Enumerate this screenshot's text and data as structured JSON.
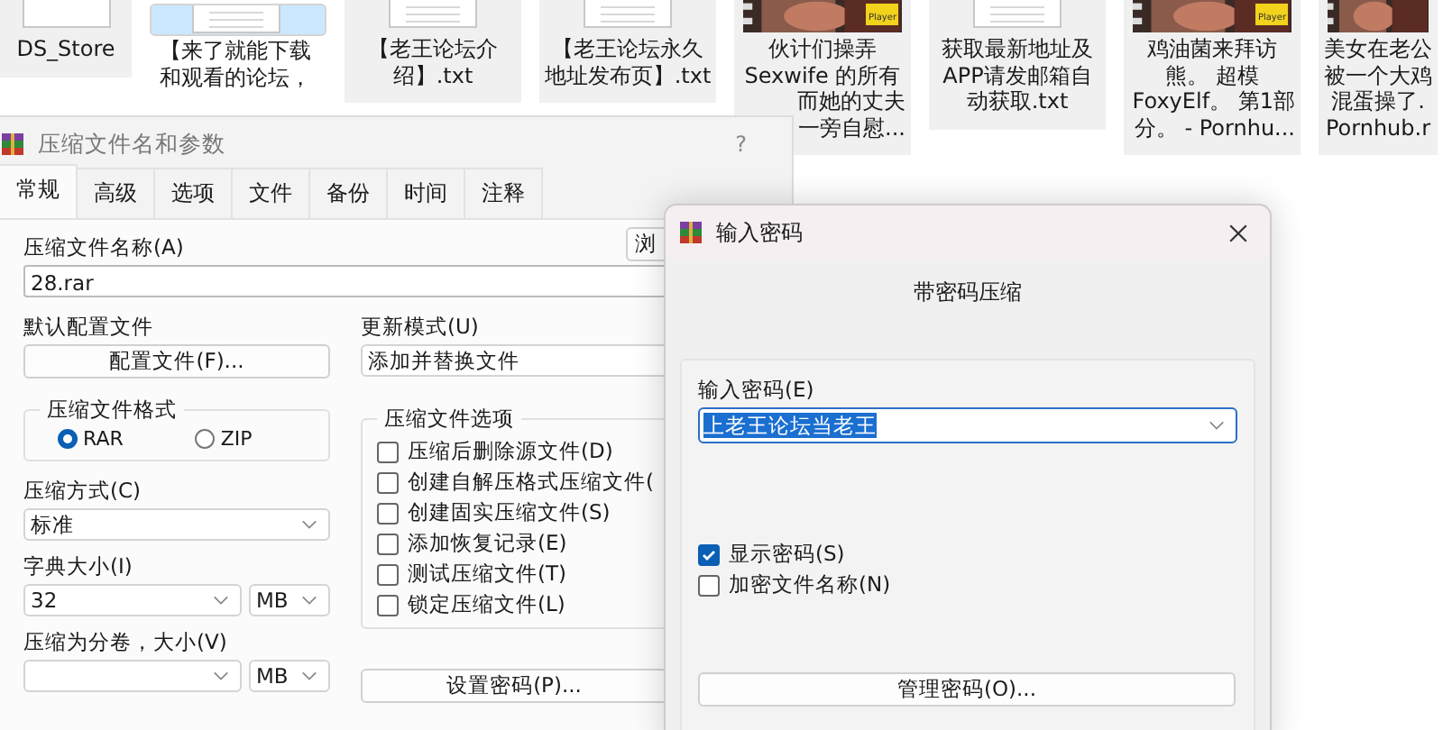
{
  "explorer": {
    "files": [
      {
        "kind": "file",
        "selected": false,
        "lines": [
          "DS_Store"
        ]
      },
      {
        "kind": "document",
        "selected": true,
        "lines": [
          "【来了就能下载",
          "和观看的论坛，"
        ]
      },
      {
        "kind": "document",
        "selected": false,
        "lines": [
          "【老王论坛介",
          "绍】.txt"
        ]
      },
      {
        "kind": "document",
        "selected": false,
        "lines": [
          "【老王论坛永久",
          "地址发布页】.txt"
        ]
      },
      {
        "kind": "video",
        "selected": false,
        "badge": "Player",
        "lines": [
          "伙计们操弄",
          "Sexwife 的所有",
          "而她的丈夫",
          "一旁自慰..."
        ]
      },
      {
        "kind": "document",
        "selected": false,
        "lines": [
          "获取最新地址及",
          "APP请发邮箱自",
          "动获取.txt"
        ]
      },
      {
        "kind": "video",
        "selected": false,
        "badge": "Player",
        "lines": [
          "鸡油菌来拜访",
          "熊。 超模",
          "FoxyElf。 第1部",
          "分。 - Pornhu..."
        ]
      },
      {
        "kind": "video",
        "selected": false,
        "lines": [
          "美女在老公",
          "被一个大鸡",
          "混蛋操了.",
          "Pornhub.r"
        ]
      }
    ]
  },
  "archive_dialog": {
    "title": "压缩文件名和参数",
    "help": "?",
    "tabs": [
      {
        "label": "常规",
        "selected": true
      },
      {
        "label": "高级",
        "selected": false
      },
      {
        "label": "选项",
        "selected": false
      },
      {
        "label": "文件",
        "selected": false
      },
      {
        "label": "备份",
        "selected": false
      },
      {
        "label": "时间",
        "selected": false
      },
      {
        "label": "注释",
        "selected": false
      }
    ],
    "archive_name_label": "压缩文件名称(A)",
    "browse_button": "浏",
    "archive_name": "28.rar",
    "profile_label": "默认配置文件",
    "profile_button": "配置文件(F)...",
    "update_mode_label": "更新模式(U)",
    "update_mode": "添加并替换文件",
    "format_group": {
      "title": "压缩文件格式",
      "options": [
        {
          "label": "RAR",
          "selected": true
        },
        {
          "label": "ZIP",
          "selected": false
        }
      ]
    },
    "options_group": {
      "title": "压缩文件选项",
      "items": [
        {
          "label": "压缩后删除源文件(D)",
          "checked": false
        },
        {
          "label": "创建自解压格式压缩文件(",
          "checked": false
        },
        {
          "label": "创建固实压缩文件(S)",
          "checked": false
        },
        {
          "label": "添加恢复记录(E)",
          "checked": false
        },
        {
          "label": "测试压缩文件(T)",
          "checked": false
        },
        {
          "label": "锁定压缩文件(L)",
          "checked": false
        }
      ]
    },
    "method_label": "压缩方式(C)",
    "method": "标准",
    "dict_label": "字典大小(I)",
    "dict_size": "32",
    "dict_unit": "MB",
    "volume_label": "压缩为分卷，大小(V)",
    "volume_unit": "MB",
    "password_button": "设置密码(P)..."
  },
  "password_dialog": {
    "title": "输入密码",
    "heading": "带密码压缩",
    "password_label": "输入密码(E)",
    "password": "上老王论坛当老王",
    "checks": [
      {
        "label": "显示密码(S)",
        "checked": true
      },
      {
        "label": "加密文件名称(N)",
        "checked": false
      }
    ],
    "manage_button": "管理密码(O)..."
  }
}
